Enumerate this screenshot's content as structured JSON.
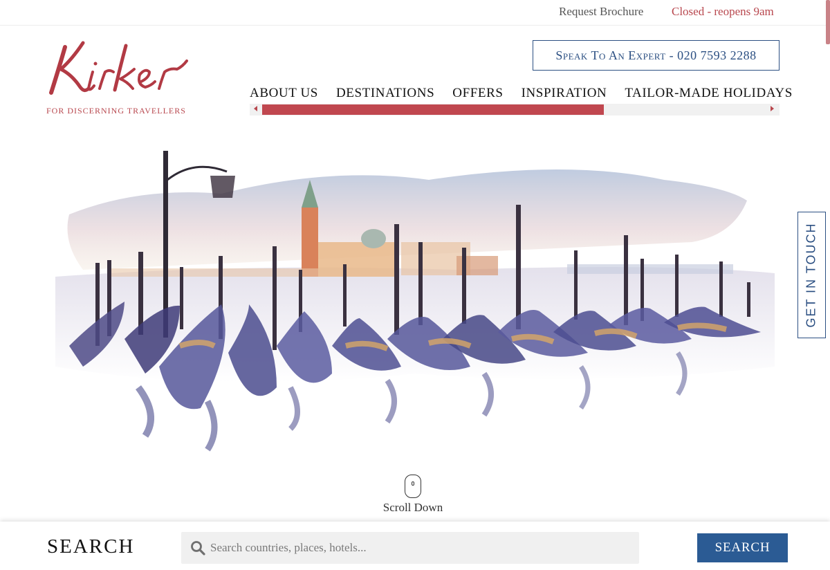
{
  "topbar": {
    "brochure_label": "Request Brochure",
    "status_text": "Closed - reopens 9am"
  },
  "logo": {
    "wordmark": "Kirker",
    "tagline": "FOR DISCERNING TRAVELLERS"
  },
  "expert_button": {
    "label": "Speak To An Expert - 020 7593 2288"
  },
  "nav": {
    "items": [
      {
        "label": "ABOUT US"
      },
      {
        "label": "DESTINATIONS"
      },
      {
        "label": "OFFERS"
      },
      {
        "label": "INSPIRATION"
      },
      {
        "label": "TAILOR-MADE HOLIDAYS"
      }
    ]
  },
  "hero": {
    "icon": "venice-gondolas-watercolour"
  },
  "side_tab": {
    "label": "GET IN TOUCH"
  },
  "scroll_down": {
    "label": "Scroll Down"
  },
  "search": {
    "heading": "SEARCH",
    "placeholder": "Search countries, places, hotels...",
    "value": "",
    "button_label": "SEARCH"
  },
  "colors": {
    "brand_red": "#b8474e",
    "brand_blue": "#2b4f82",
    "button_blue": "#2b5b94"
  }
}
